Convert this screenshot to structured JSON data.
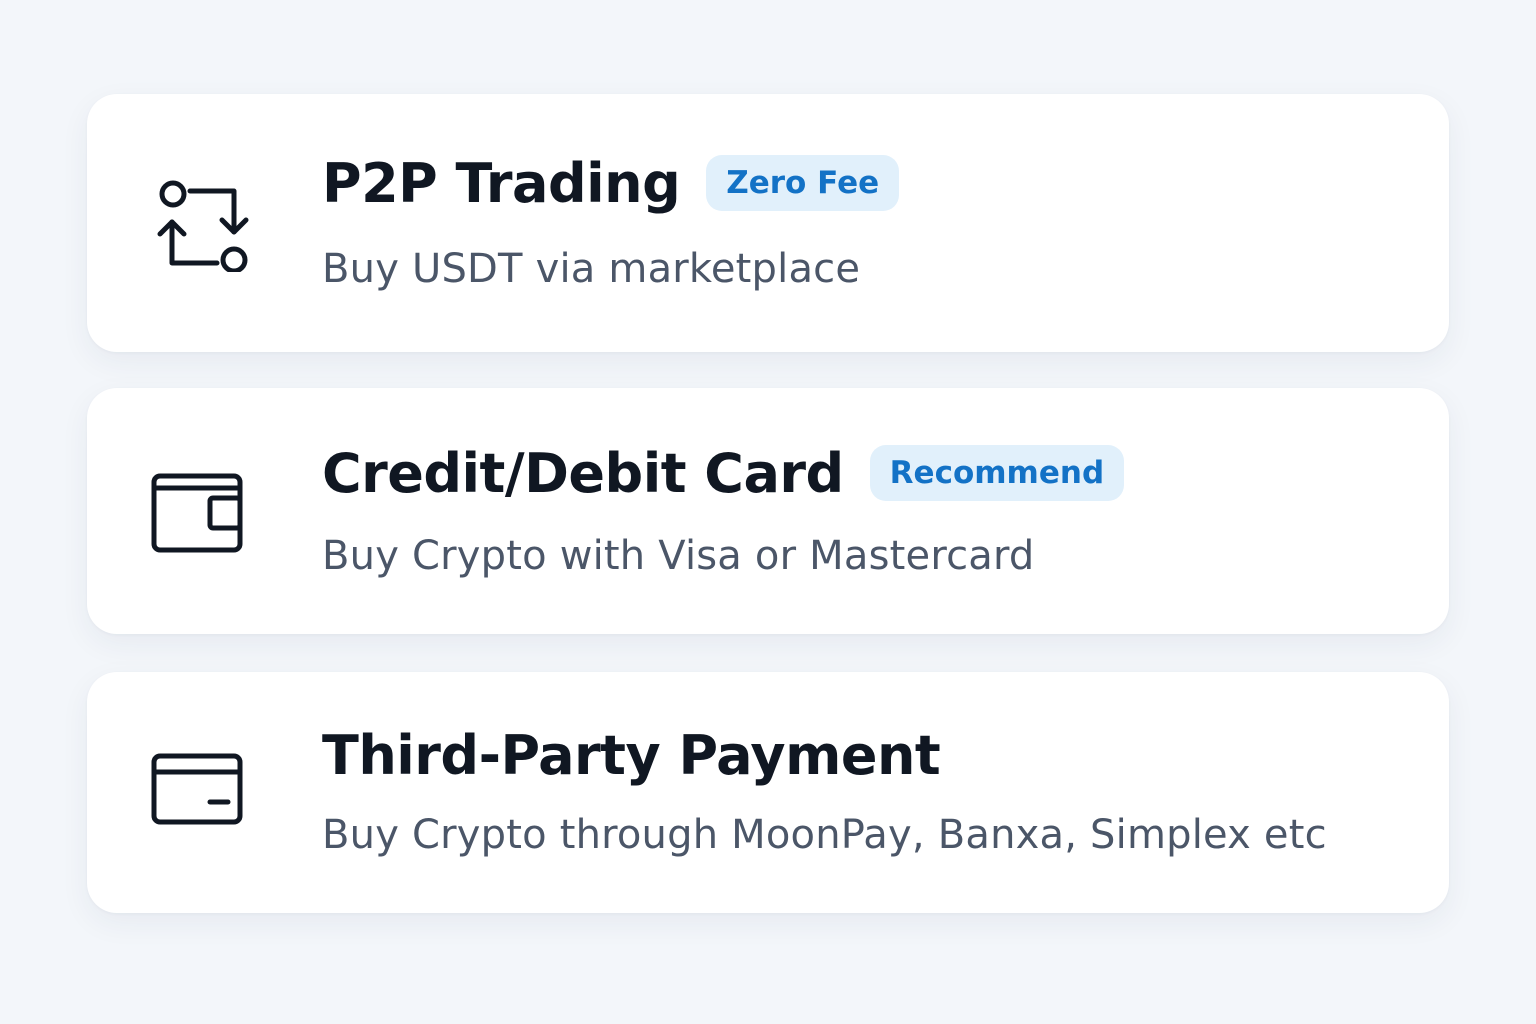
{
  "options": [
    {
      "title": "P2P Trading",
      "badge": "Zero Fee",
      "subtitle": "Buy USDT via marketplace",
      "icon": "swap-arrows-icon"
    },
    {
      "title": "Credit/Debit Card",
      "badge": "Recommend",
      "subtitle": "Buy Crypto with Visa or Mastercard",
      "icon": "wallet-icon"
    },
    {
      "title": "Third-Party Payment",
      "subtitle": "Buy Crypto through MoonPay, Banxa, Simplex etc",
      "icon": "card-icon"
    }
  ],
  "colors": {
    "background": "#f3f6fa",
    "card": "#ffffff",
    "title": "#101722",
    "subtitle": "#4b5668",
    "badge_bg": "#e1f0fb",
    "badge_text": "#1372c6"
  }
}
